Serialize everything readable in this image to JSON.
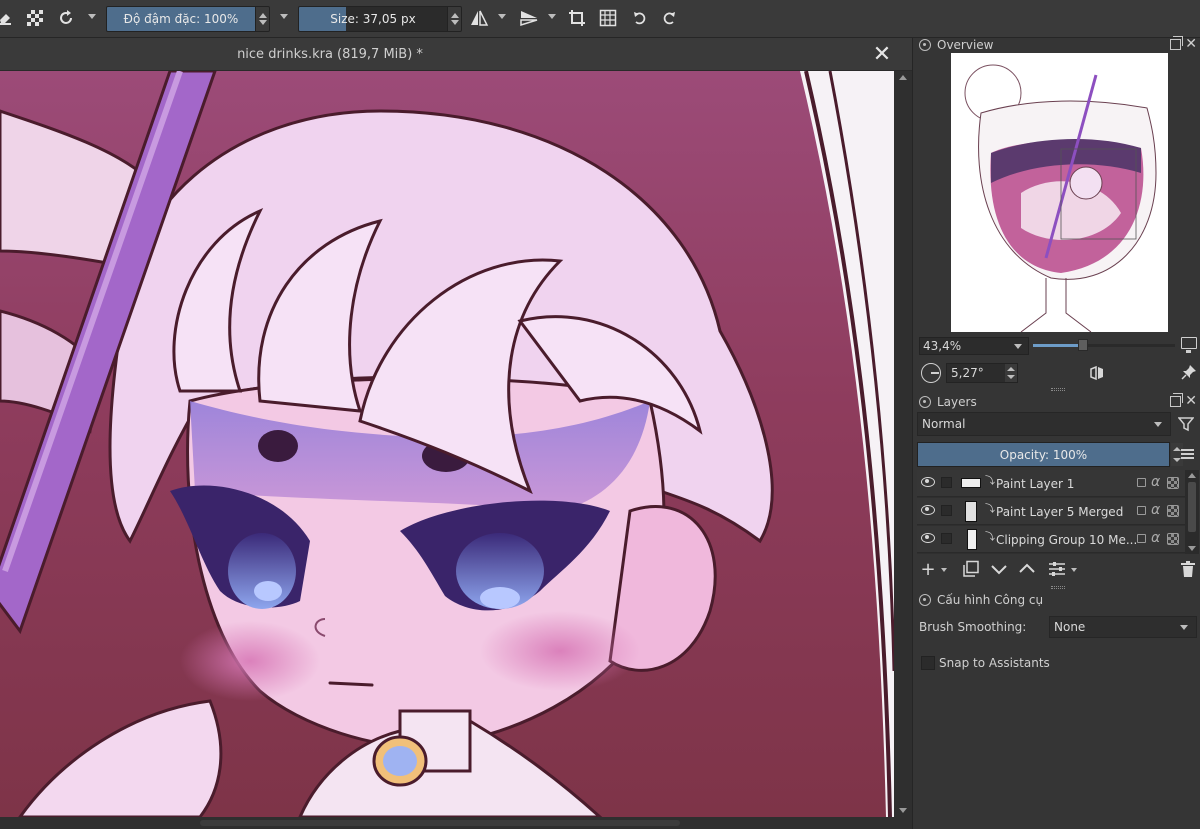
{
  "toolbar": {
    "opacity_label": "Độ đậm đặc: 100%",
    "opacity_fraction": 1.0,
    "size_label": "Size: 37,05 px",
    "size_fraction": 0.32
  },
  "document": {
    "title": "nice drinks.kra (819,7 MiB) *",
    "close_glyph": "✕"
  },
  "overview": {
    "title": "Overview",
    "zoom_value": "43,4%",
    "zoom_fraction": 0.35,
    "rotation_value": "5,27°"
  },
  "layers": {
    "title": "Layers",
    "blend_mode": "Normal",
    "opacity_label": "Opacity:  100%",
    "opacity_fraction": 1.0,
    "items": [
      {
        "name": "Paint Layer 1",
        "alpha": "α"
      },
      {
        "name": "Paint Layer 5 Merged",
        "alpha": "α"
      },
      {
        "name": "Clipping Group 10 Me...",
        "alpha": "α"
      }
    ]
  },
  "tool_options": {
    "title": "Cấu hình Công cụ",
    "brush_smoothing_label": "Brush Smoothing:",
    "brush_smoothing_value": "None",
    "snap_label": "Snap to Assistants"
  },
  "colors": {
    "accent_fill": "#4e6d8c",
    "panel_bg": "#353535",
    "canvas_bg": "#8c3a57"
  },
  "icons": [
    "eraser-icon",
    "checker-icon",
    "refresh-icon",
    "mirror-h-icon",
    "mirror-v-icon",
    "crop-icon",
    "wrap-icon",
    "undo-icon",
    "redo-icon",
    "close-icon",
    "float-icon",
    "filter-icon",
    "menu-icon",
    "eye-icon",
    "lock-icon",
    "add-icon",
    "duplicate-icon",
    "move-down-icon",
    "move-up-icon",
    "properties-icon",
    "trash-icon",
    "pin-icon",
    "monitor-icon"
  ]
}
